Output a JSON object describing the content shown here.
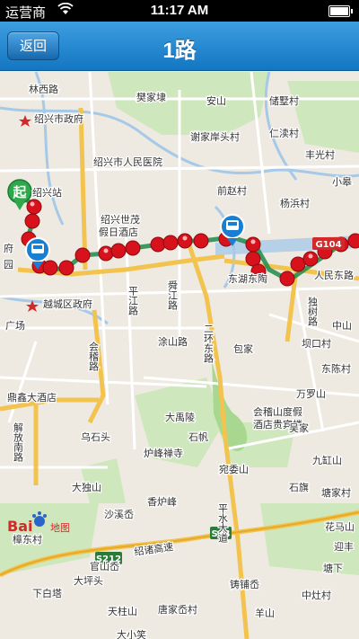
{
  "status_bar": {
    "carrier": "运营商",
    "time": "11:17 AM"
  },
  "nav": {
    "back_label": "返回",
    "title": "1路"
  },
  "map": {
    "start_marker": "起",
    "road_badges": {
      "g104": "G104",
      "s212": "S212",
      "s24": "S24"
    },
    "logo": {
      "baidu_prefix": "Bai",
      "baidu_suffix": "地图"
    },
    "labels": [
      {
        "id": "lbl-1",
        "text": "林西路"
      },
      {
        "id": "lbl-2",
        "text": "绍兴市政府"
      },
      {
        "id": "lbl-3",
        "text": "绍兴市人民医院"
      },
      {
        "id": "lbl-4",
        "text": "绍兴站"
      },
      {
        "id": "lbl-5",
        "text": "绍兴世茂"
      },
      {
        "id": "lbl-6",
        "text": "假日酒店"
      },
      {
        "id": "lbl-7",
        "text": "越城区政府"
      },
      {
        "id": "lbl-8",
        "text": "广场"
      },
      {
        "id": "lbl-9",
        "text": "鼎鑫大酒店"
      },
      {
        "id": "lbl-10",
        "text": "解放南路"
      },
      {
        "id": "lbl-11",
        "text": "会稽路"
      },
      {
        "id": "lbl-12",
        "text": "平江路"
      },
      {
        "id": "lbl-13",
        "text": "舜江路"
      },
      {
        "id": "lbl-14",
        "text": "涂山路"
      },
      {
        "id": "lbl-15",
        "text": "二环东路"
      },
      {
        "id": "lbl-16",
        "text": "东湖"
      },
      {
        "id": "lbl-17",
        "text": "樊家埭"
      },
      {
        "id": "lbl-18",
        "text": "安山"
      },
      {
        "id": "lbl-19",
        "text": "谢家岸头村"
      },
      {
        "id": "lbl-20",
        "text": "储墅村"
      },
      {
        "id": "lbl-21",
        "text": "仁渎村"
      },
      {
        "id": "lbl-22",
        "text": "丰光村"
      },
      {
        "id": "lbl-23",
        "text": "小皋"
      },
      {
        "id": "lbl-24",
        "text": "前赵村"
      },
      {
        "id": "lbl-25",
        "text": "杨浜村"
      },
      {
        "id": "lbl-26",
        "text": "人民东路"
      },
      {
        "id": "lbl-27",
        "text": "独树路"
      },
      {
        "id": "lbl-28",
        "text": "中山"
      },
      {
        "id": "lbl-29",
        "text": "包家"
      },
      {
        "id": "lbl-30",
        "text": "坝口村"
      },
      {
        "id": "lbl-31",
        "text": "东陈村"
      },
      {
        "id": "lbl-32",
        "text": "万罗山"
      },
      {
        "id": "lbl-33",
        "text": "会稽山度假"
      },
      {
        "id": "lbl-34",
        "text": "酒店贵宾楼"
      },
      {
        "id": "lbl-35",
        "text": "吴家"
      },
      {
        "id": "lbl-36",
        "text": "九缸山"
      },
      {
        "id": "lbl-37",
        "text": "大禹陵"
      },
      {
        "id": "lbl-38",
        "text": "石帆"
      },
      {
        "id": "lbl-39",
        "text": "炉峰禅寺"
      },
      {
        "id": "lbl-40",
        "text": "宛委山"
      },
      {
        "id": "lbl-41",
        "text": "香炉峰"
      },
      {
        "id": "lbl-42",
        "text": "乌石头"
      },
      {
        "id": "lbl-43",
        "text": "大独山"
      },
      {
        "id": "lbl-44",
        "text": "沙溪岙"
      },
      {
        "id": "lbl-45",
        "text": "石旗"
      },
      {
        "id": "lbl-46",
        "text": "塘家村"
      },
      {
        "id": "lbl-47",
        "text": "花马山"
      },
      {
        "id": "lbl-48",
        "text": "迎丰"
      },
      {
        "id": "lbl-49",
        "text": "绍诸高速"
      },
      {
        "id": "lbl-50",
        "text": "平水大道"
      },
      {
        "id": "lbl-51",
        "text": "官山岙"
      },
      {
        "id": "lbl-52",
        "text": "铸铺岙"
      },
      {
        "id": "lbl-53",
        "text": "下白塔"
      },
      {
        "id": "lbl-54",
        "text": "大坪头"
      },
      {
        "id": "lbl-55",
        "text": "天柱山"
      },
      {
        "id": "lbl-56",
        "text": "唐家岙村"
      },
      {
        "id": "lbl-57",
        "text": "羊山"
      },
      {
        "id": "lbl-58",
        "text": "中灶村"
      },
      {
        "id": "lbl-59",
        "text": "塘下"
      },
      {
        "id": "lbl-60",
        "text": "樟东村"
      },
      {
        "id": "lbl-61",
        "text": "大小笑"
      },
      {
        "id": "lbl-62",
        "text": "府"
      },
      {
        "id": "lbl-63",
        "text": "园"
      },
      {
        "id": "lbl-64",
        "text": "东陶"
      }
    ]
  }
}
